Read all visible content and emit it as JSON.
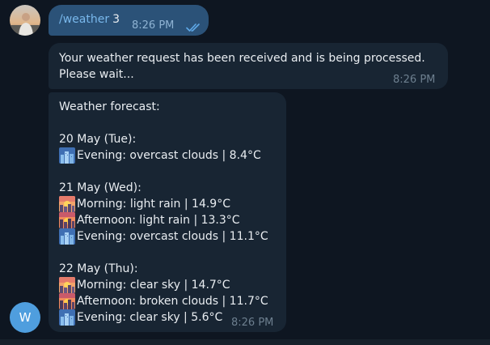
{
  "user_message": {
    "command": "/weather",
    "argument": "3",
    "time": "8:26 PM"
  },
  "bot_ack": {
    "line1": "Your weather request has been received and is being processed.",
    "line2": "Please wait...",
    "time": "8:26 PM"
  },
  "forecast": {
    "header": "Weather forecast:",
    "days": [
      {
        "date": "20 May (Tue):",
        "entries": [
          {
            "icon": "evening-city-icon",
            "text": "Evening: overcast clouds | 8.4°C"
          }
        ]
      },
      {
        "date": "21 May (Wed):",
        "entries": [
          {
            "icon": "sunrise-city-icon",
            "text": "Morning: light rain | 14.9°C"
          },
          {
            "icon": "sunset-city-icon",
            "text": "Afternoon: light rain | 13.3°C"
          },
          {
            "icon": "evening-city-icon",
            "text": "Evening: overcast clouds | 11.1°C"
          }
        ]
      },
      {
        "date": "22 May (Thu):",
        "entries": [
          {
            "icon": "sunrise-city-icon",
            "text": "Morning: clear sky | 14.7°C"
          },
          {
            "icon": "sunset-city-icon",
            "text": "Afternoon: broken clouds | 11.7°C"
          },
          {
            "icon": "evening-city-icon",
            "text": "Evening: clear sky | 5.6°C"
          }
        ]
      }
    ],
    "time": "8:26 PM"
  },
  "bot_avatar": {
    "initial": "W",
    "color": "#4f9ede"
  },
  "colors": {
    "background": "#0e1621",
    "outgoing_bubble": "#2b5278",
    "incoming_bubble": "#182533",
    "command_link": "#79b8ec"
  }
}
